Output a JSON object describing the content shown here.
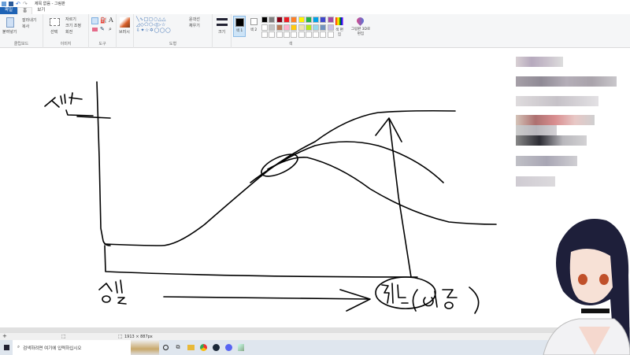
{
  "window": {
    "title": "제목 없음 - 그림판"
  },
  "tabs": [
    {
      "label": "파일"
    },
    {
      "label": "홈"
    },
    {
      "label": "보기"
    }
  ],
  "ribbon": {
    "clipboard": {
      "paste": "붙여넣기",
      "cut": "잘라내기",
      "copy": "복사",
      "group": "클립보드"
    },
    "image": {
      "select": "선택",
      "crop": "자르기",
      "resize": "크기 조정",
      "rotate": "회전",
      "group": "이미지"
    },
    "tools": {
      "group": "도구"
    },
    "brushes": {
      "label": "브러시"
    },
    "shapes": {
      "outline": "윤곽선",
      "fill": "채우기",
      "group": "도형"
    },
    "size": {
      "label": "크기"
    },
    "colors": {
      "color1": "색 1",
      "color2": "색 2",
      "edit": "색 편집",
      "paint3d": "그림판 3D로 편집",
      "group": "색",
      "palette": [
        "#000000",
        "#7f7f7f",
        "#880015",
        "#ed1c24",
        "#ff7f27",
        "#fff200",
        "#22b14c",
        "#00a2e8",
        "#3f48cc",
        "#a349a4",
        "#ffffff",
        "#c3c3c3",
        "#b97a57",
        "#ffaec9",
        "#ffc90e",
        "#efe4b0",
        "#b5e61d",
        "#99d9ea",
        "#7092be",
        "#c8bfe7"
      ],
      "color1_value": "#000000",
      "color2_value": "#ffffff"
    }
  },
  "status": {
    "dimensions": "1913 × 887px"
  },
  "taskbar": {
    "search_placeholder": "검색하려면 여기에 입력하십시오"
  },
  "accent": "#1e63b5"
}
